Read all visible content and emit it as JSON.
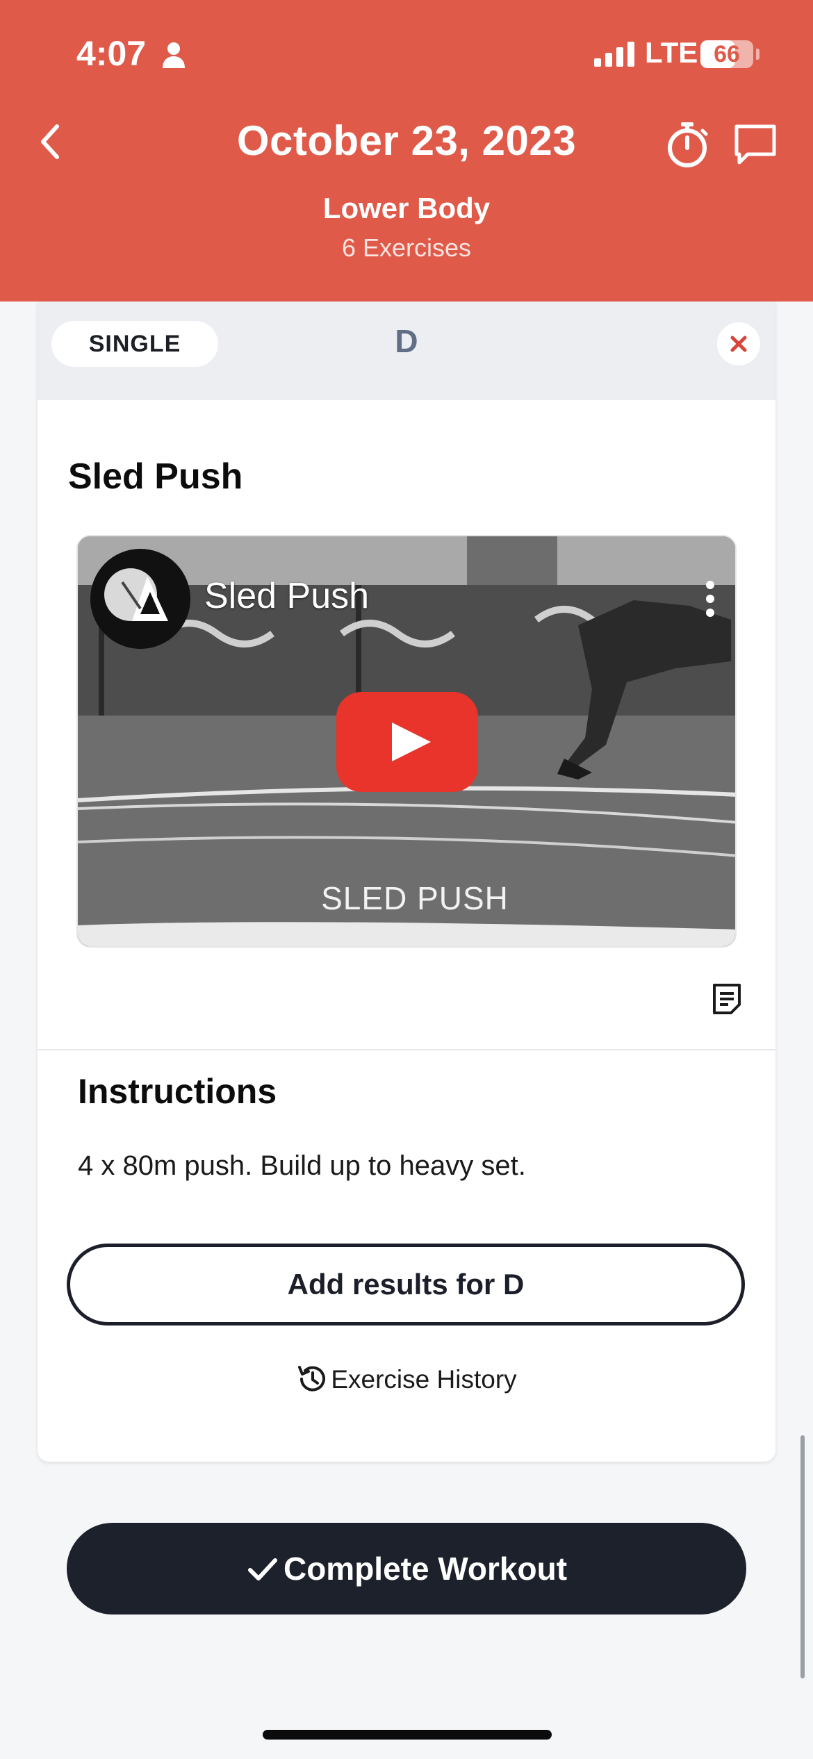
{
  "status_bar": {
    "time": "4:07",
    "network": "LTE",
    "battery": "66",
    "battery_level": 0.66
  },
  "header": {
    "title": "October 23, 2023",
    "subtitle": "Lower Body",
    "count": "6 Exercises",
    "icons": [
      "back-icon",
      "stopwatch-icon",
      "chat-icon"
    ]
  },
  "block": {
    "type_label": "SINGLE",
    "letter": "D"
  },
  "exercise": {
    "name": "Sled Push",
    "video": {
      "title": "Sled Push",
      "caption": "SLED PUSH"
    },
    "instructions_heading": "Instructions",
    "instructions_text": "4 x 80m push. Build up to heavy set.",
    "add_results_label": "Add results for D",
    "history_label": "Exercise History"
  },
  "footer": {
    "complete_label": "Complete Workout"
  },
  "colors": {
    "brand": "#e05a4a",
    "dark_button": "#1d212b",
    "remove": "#d9443a",
    "play": "#e8342a"
  }
}
